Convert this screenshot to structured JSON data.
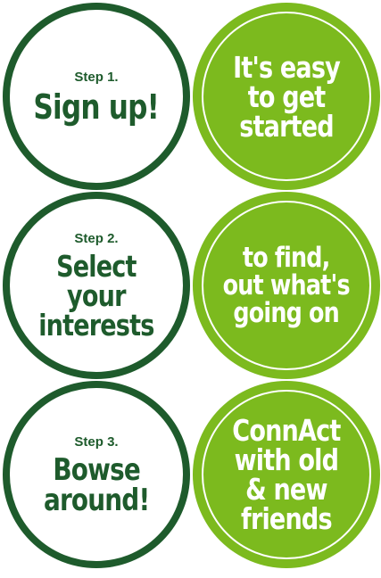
{
  "colors": {
    "dark_green": "#1e5b2c",
    "bright_green": "#7cba1e",
    "white": "#ffffff"
  },
  "badges": [
    {
      "step": "Step 1.",
      "lines": [
        "Sign up!"
      ]
    },
    {
      "lines": [
        "It's easy",
        "to get",
        "started"
      ]
    },
    {
      "step": "Step 2.",
      "lines": [
        "Select",
        "your",
        "interests"
      ]
    },
    {
      "lines": [
        "to find,",
        "out what's",
        "going on"
      ]
    },
    {
      "step": "Step 3.",
      "lines": [
        "Bowse",
        "around!"
      ]
    },
    {
      "lines": [
        "ConnAct",
        "with old",
        "& new",
        "friends"
      ]
    }
  ]
}
